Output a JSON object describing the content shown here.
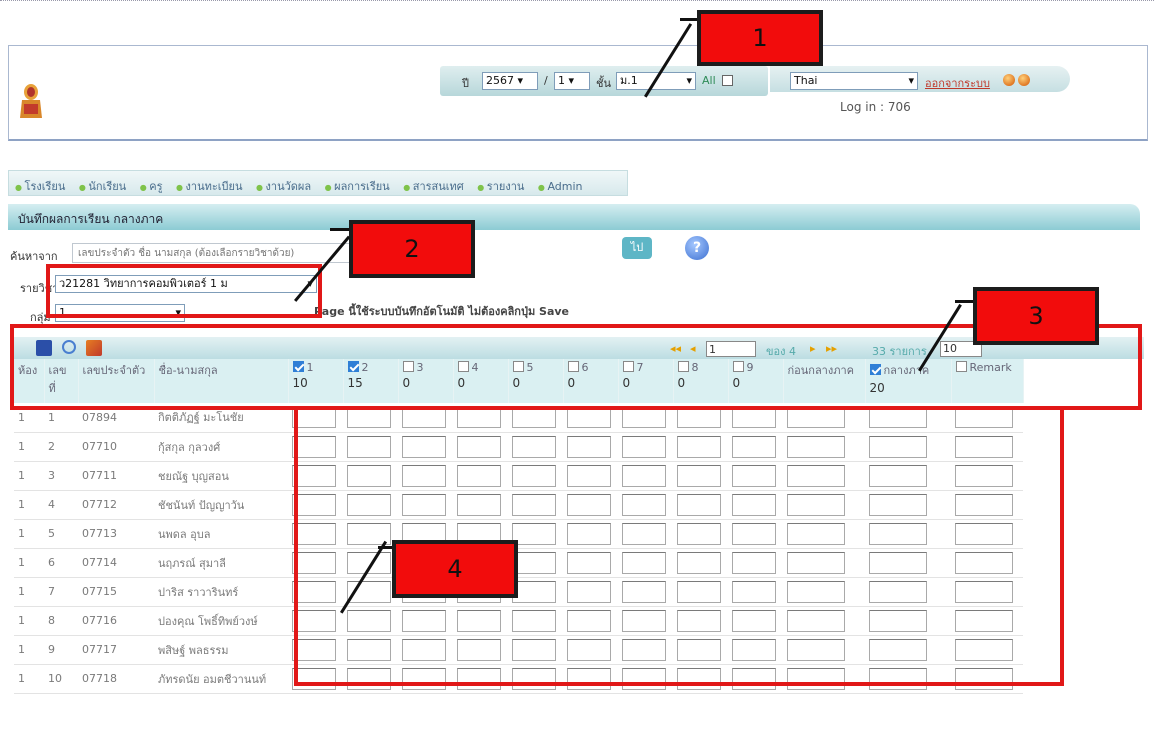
{
  "header": {
    "year_label": "ปี",
    "year": "2567",
    "term": "1",
    "class_label": "ชั้น",
    "class_value": "ม.1",
    "all_label": "All",
    "language": "Thai",
    "logout": "ออกจากระบบ",
    "login_info": "Log in : 706"
  },
  "nav": [
    "โรงเรียน",
    "นักเรียน",
    "ครู",
    "งานทะเบียน",
    "งานวัดผล",
    "ผลการเรียน",
    "สารสนเทศ",
    "รายงาน",
    "Admin"
  ],
  "title": "บันทึกผลการเรียน กลางภาค",
  "search": {
    "label": "ค้นหาจาก",
    "placeholder": "เลขประจำตัว ชื่อ นามสกุล (ต้องเลือกรายวิชาด้วย)",
    "go": "ไป"
  },
  "subject": {
    "label": "รายวิชา",
    "value": "ว21281 วิทยาการคอมพิวเตอร์ 1 ม"
  },
  "group": {
    "label": "กลุ่ม",
    "value": "1"
  },
  "note": "Page นี้ใช้ระบบบันทึกอัตโนมัติ ไม่ต้องคลิกปุ่ม Save",
  "pager": {
    "page": "1",
    "of_label": "ของ 4",
    "count": "33 รายการ",
    "rows": "10"
  },
  "columns": {
    "room": "ห้อง",
    "no": "เลขที่",
    "id": "เลขประจำตัว",
    "name": "ชื่อ-นามสกุล",
    "before_mid": "ก่อนกลางภาค",
    "mid": "กลางภาค",
    "remark": "Remark"
  },
  "score_cols": [
    {
      "label": "1",
      "max": "10",
      "checked": true
    },
    {
      "label": "2",
      "max": "15",
      "checked": true
    },
    {
      "label": "3",
      "max": "0",
      "checked": false
    },
    {
      "label": "4",
      "max": "0",
      "checked": false
    },
    {
      "label": "5",
      "max": "0",
      "checked": false
    },
    {
      "label": "6",
      "max": "0",
      "checked": false
    },
    {
      "label": "7",
      "max": "0",
      "checked": false
    },
    {
      "label": "8",
      "max": "0",
      "checked": false
    },
    {
      "label": "9",
      "max": "0",
      "checked": false
    }
  ],
  "mid_max": "20",
  "rows": [
    {
      "room": "1",
      "no": "1",
      "id": "07894",
      "name": "กิตติภัฏฐ์ มะโนชัย"
    },
    {
      "room": "1",
      "no": "2",
      "id": "07710",
      "name": "กุ้สกุล กุลวงศ์"
    },
    {
      "room": "1",
      "no": "3",
      "id": "07711",
      "name": "ชยณัฐ บุญสอน"
    },
    {
      "room": "1",
      "no": "4",
      "id": "07712",
      "name": "ชัชนันท์ ปัญญาวัน"
    },
    {
      "room": "1",
      "no": "5",
      "id": "07713",
      "name": "นพดล อุบล"
    },
    {
      "room": "1",
      "no": "6",
      "id": "07714",
      "name": "นฤภรณ์ สุมาลี"
    },
    {
      "room": "1",
      "no": "7",
      "id": "07715",
      "name": "ปาริส ราวารินทร์"
    },
    {
      "room": "1",
      "no": "8",
      "id": "07716",
      "name": "ปองคุณ โพธิ์ทิพย์วงษ์"
    },
    {
      "room": "1",
      "no": "9",
      "id": "07717",
      "name": "พสิษฐ์ พลธรรม"
    },
    {
      "room": "1",
      "no": "10",
      "id": "07718",
      "name": "ภัทรดนัย อมตชีวานนท์"
    }
  ],
  "annotations": [
    "1",
    "2",
    "3",
    "4"
  ]
}
